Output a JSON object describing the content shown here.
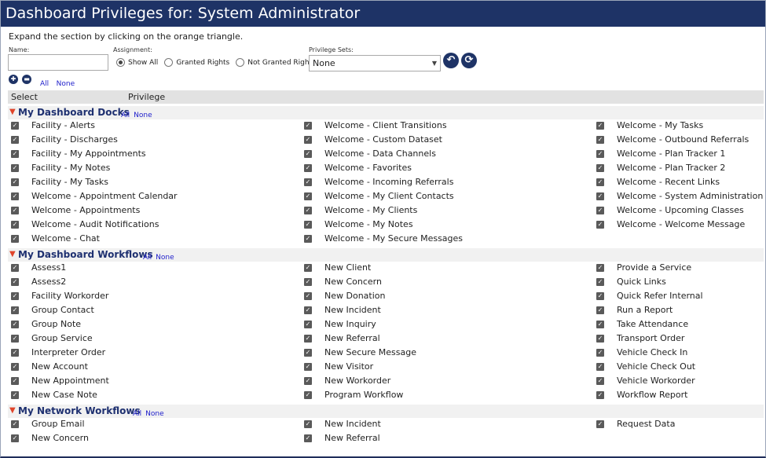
{
  "title": "Dashboard Privileges for: System Administrator",
  "instruction": "Expand the section by clicking on the orange triangle.",
  "filters": {
    "name_label": "Name:",
    "name_value": "",
    "assignment_label": "Assignment:",
    "assignment_options": [
      "Show All",
      "Granted Rights",
      "Not Granted Rights"
    ],
    "assignment_selected": "Show All",
    "privilege_sets_label": "Privilege Sets:",
    "privilege_sets_value": "None"
  },
  "top_links": {
    "all": "All",
    "none": "None"
  },
  "header": {
    "select": "Select",
    "privilege": "Privilege"
  },
  "sections": [
    {
      "title": "My Dashboard Docks",
      "all": "All",
      "none": "None",
      "columns": [
        [
          "Facility - Alerts",
          "Facility - Discharges",
          "Facility - My Appointments",
          "Facility - My Notes",
          "Facility - My Tasks",
          "Welcome - Appointment Calendar",
          "Welcome - Appointments",
          "Welcome - Audit Notifications",
          "Welcome - Chat"
        ],
        [
          "Welcome - Client Transitions",
          "Welcome - Custom Dataset",
          "Welcome - Data Channels",
          "Welcome - Favorites",
          "Welcome - Incoming Referrals",
          "Welcome - My Client Contacts",
          "Welcome - My Clients",
          "Welcome - My Notes",
          "Welcome - My Secure Messages"
        ],
        [
          "Welcome - My Tasks",
          "Welcome - Outbound Referrals",
          "Welcome - Plan Tracker 1",
          "Welcome - Plan Tracker 2",
          "Welcome - Recent Links",
          "Welcome - System Administration",
          "Welcome - Upcoming Classes",
          "Welcome - Welcome Message"
        ]
      ]
    },
    {
      "title": "My Dashboard Workflows",
      "all": "All",
      "none": "None",
      "columns": [
        [
          "Assess1",
          "Assess2",
          "Facility Workorder",
          "Group Contact",
          "Group Note",
          "Group Service",
          "Interpreter Order",
          "New Account",
          "New Appointment",
          "New Case Note"
        ],
        [
          "New Client",
          "New Concern",
          "New Donation",
          "New Incident",
          "New Inquiry",
          "New Referral",
          "New Secure Message",
          "New Visitor",
          "New Workorder",
          "Program Workflow"
        ],
        [
          "Provide a Service",
          "Quick Links",
          "Quick Refer Internal",
          "Run a Report",
          "Take Attendance",
          "Transport Order",
          "Vehicle Check In",
          "Vehicle Check Out",
          "Vehicle Workorder",
          "Workflow Report"
        ]
      ]
    },
    {
      "title": "My Network Workflows",
      "all": "All",
      "none": "None",
      "columns": [
        [
          "Group Email",
          "New Concern"
        ],
        [
          "New Incident",
          "New Referral"
        ],
        [
          "Request Data"
        ]
      ]
    }
  ]
}
